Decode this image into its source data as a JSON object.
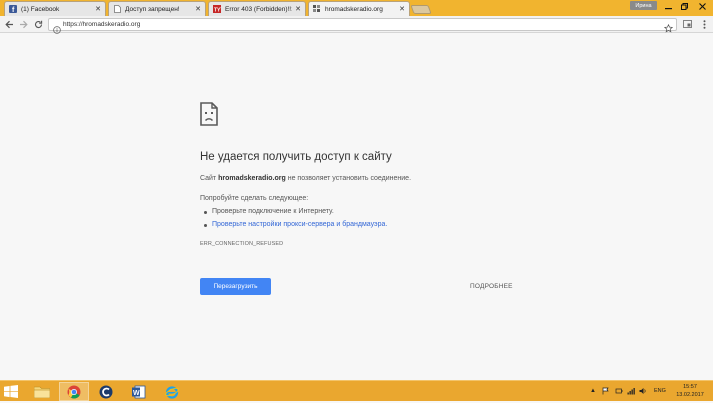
{
  "tabs": [
    {
      "label": "(1) Facebook",
      "icon": "facebook-icon"
    },
    {
      "label": "Доступ запрещен!",
      "icon": "page-icon"
    },
    {
      "label": "Error 403 (Forbidden)!!1",
      "icon": "error-page-icon"
    },
    {
      "label": "hromadskeradio.org",
      "icon": "site-icon"
    }
  ],
  "window": {
    "user_label": "Ирина"
  },
  "omnibox": {
    "url": "https://hromadskeradio.org"
  },
  "error": {
    "title": "Не удается получить доступ к сайту",
    "desc_prefix": "Сайт ",
    "desc_host": "hromadskeradio.org",
    "desc_suffix": " не позволяет установить соединение.",
    "try_label": "Попробуйте сделать следующее:",
    "suggestions": [
      "Проверьте подключение к Интернету.",
      "Проверьте настройки прокси-сервера и брандмауэра."
    ],
    "code": "ERR_CONNECTION_REFUSED",
    "reload_label": "Перезагрузить",
    "details_label": "ПОДРОБНЕЕ"
  },
  "taskbar": {
    "lang": "ENG",
    "time": "15:57",
    "date": "13.02.2017"
  },
  "colors": {
    "accent": "#4285f4",
    "link": "#3367d6",
    "titlebar": "#f1b42f",
    "taskbar": "#eaa72f"
  }
}
